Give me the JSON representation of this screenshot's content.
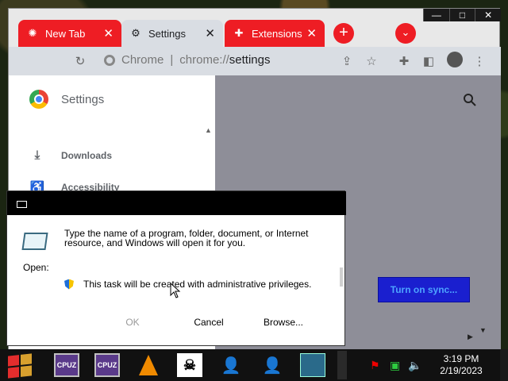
{
  "browser": {
    "tabs": [
      {
        "label": "New Tab",
        "icon": "new-tab-icon"
      },
      {
        "label": "Settings",
        "icon": "gear-icon"
      },
      {
        "label": "Extensions",
        "icon": "puzzle-icon"
      }
    ],
    "window_controls": {
      "minimize": "—",
      "maximize": "□",
      "close": "✕"
    },
    "address": {
      "site": "Chrome",
      "separator": "|",
      "scheme": "chrome://",
      "path": "settings"
    },
    "sidebar": {
      "title": "Settings",
      "items": [
        {
          "label": "Downloads",
          "icon": "download-icon"
        },
        {
          "label": "Accessibility",
          "icon": "accessibility-icon"
        }
      ]
    },
    "sync_button": "Turn on sync...",
    "colors": {
      "tab_red": "#ee1d24",
      "main_bg": "#8e8e98",
      "sync_bg": "#1a1fcf"
    }
  },
  "run_dialog": {
    "description": "Type the name of a program, folder, document, or Internet resource, and Windows will open it for you.",
    "open_label": "Open:",
    "open_value": "",
    "admin_note": "This task will be created with administrative privileges.",
    "buttons": {
      "ok": "OK",
      "cancel": "Cancel",
      "browse": "Browse..."
    }
  },
  "taskbar": {
    "apps": [
      "CPU-Z",
      "CPU-Z",
      "VLC",
      "Skull",
      "User",
      "User",
      "Run"
    ],
    "cpuz_label": "CPUZ",
    "clock": {
      "time": "3:19 PM",
      "date": "2/19/2023"
    }
  }
}
